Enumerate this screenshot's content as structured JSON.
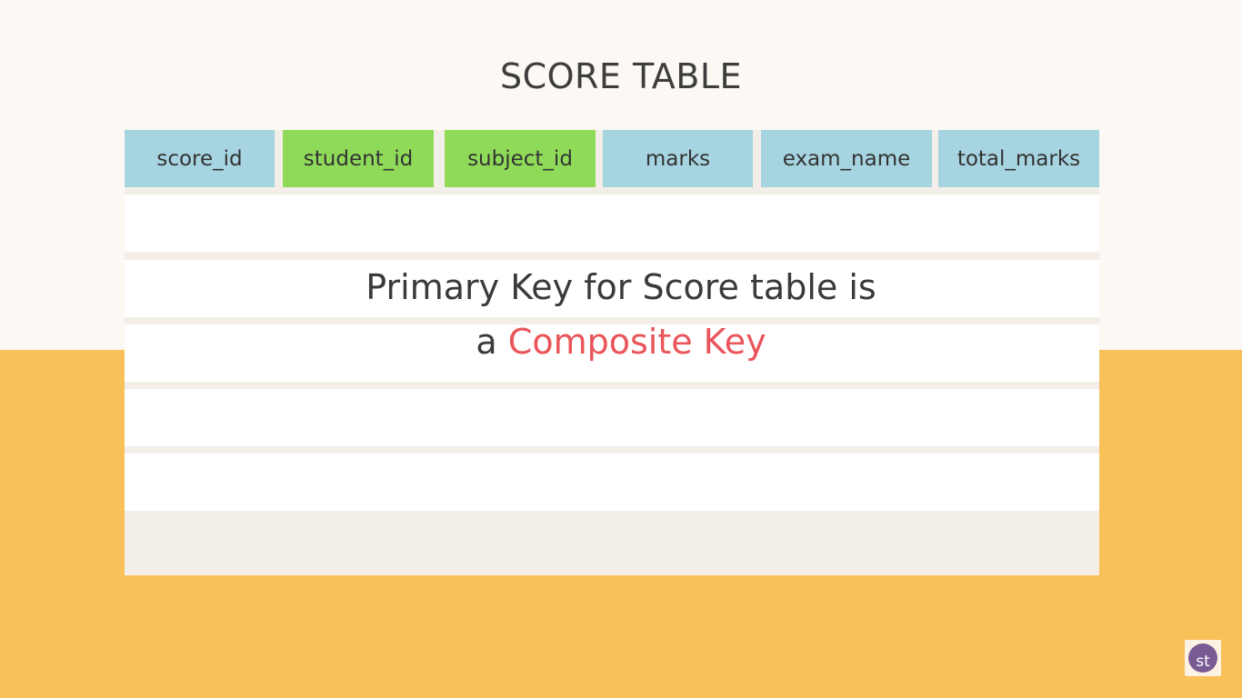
{
  "slide": {
    "title": "SCORE TABLE",
    "columns": [
      {
        "label": "score_id",
        "color": "#a6d4e0"
      },
      {
        "label": "student_id",
        "color": "#8fdb59"
      },
      {
        "label": "subject_id",
        "color": "#8fdb59"
      },
      {
        "label": "marks",
        "color": "#a6d4e0"
      },
      {
        "label": "exam_name",
        "color": "#a6d4e0"
      },
      {
        "label": "total_marks",
        "color": "#a6d4e0"
      }
    ],
    "caption": {
      "line1": "Primary Key for Score table is",
      "line2_prefix": "a ",
      "line2_highlight": "Composite Key"
    },
    "colors": {
      "background_top": "#fcf8f4",
      "background_bottom": "#f8c15a",
      "key_column": "#8fdb59",
      "regular_column": "#a6d4e0",
      "highlight_text": "#e9555a"
    }
  },
  "watermark": {
    "logo_text": "st"
  }
}
